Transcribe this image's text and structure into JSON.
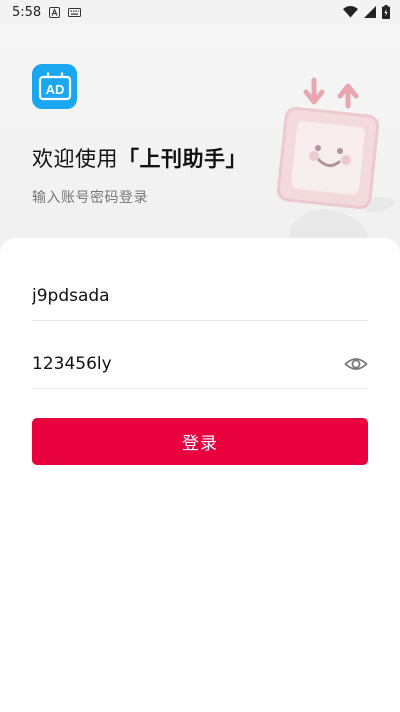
{
  "status_bar": {
    "time": "5:58"
  },
  "icons": {
    "logo": "ad-billboard-icon",
    "wifi": "wifi-icon",
    "signal": "signal-icon",
    "battery": "battery-icon",
    "eye": "eye-icon",
    "notification_a": "a-badge-icon",
    "keyboard": "keyboard-icon"
  },
  "logo": {
    "text": "AD"
  },
  "header": {
    "welcome_prefix": "欢迎使用",
    "app_name": "「上刊助手」",
    "subtitle": "输入账号密码登录"
  },
  "form": {
    "username_value": "j9pdsada",
    "password_value": "123456ly",
    "login_label": "登录"
  },
  "colors": {
    "accent": "#e8003f",
    "logo_bg": "#1aa7f0",
    "mascot": "#f4c7cc"
  }
}
